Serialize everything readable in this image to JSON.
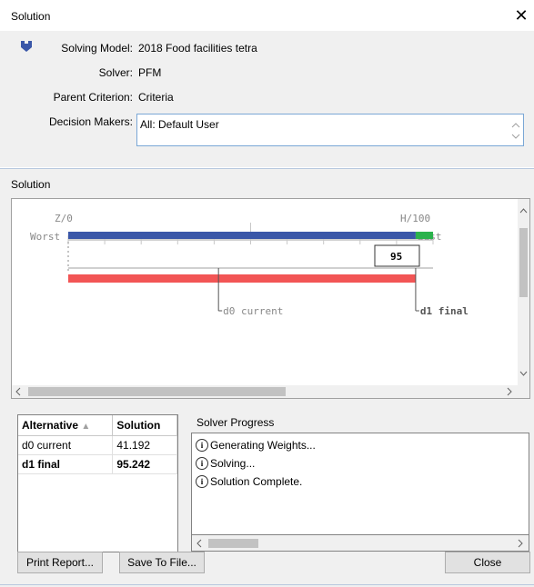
{
  "window": {
    "title": "Solution",
    "close_glyph": "✕"
  },
  "header": {
    "model_label": "Solving Model:",
    "model_value": "2018 Food facilities tetra",
    "solver_label": "Solver:",
    "solver_value": "PFM",
    "parent_label": "Parent Criterion:",
    "parent_value": "Criteria",
    "dm_label": "Decision Makers:",
    "dm_value": "All: Default User"
  },
  "section": {
    "solution_label": "Solution"
  },
  "chart_data": {
    "type": "bar",
    "left_top_label": "Z/0",
    "right_top_label": "H/100",
    "left_side_label": "Worst",
    "right_side_label": "Best",
    "score_box": "95",
    "scale": [
      0,
      100
    ],
    "colors": {
      "blue": "#3a57a8",
      "green": "#2bb24c",
      "red": "#f25555"
    },
    "markers": [
      {
        "name": "d0 current",
        "value": 41.192,
        "bold": false
      },
      {
        "name": "d1 final",
        "value": 95.242,
        "bold": true
      }
    ]
  },
  "alternatives": {
    "headers": [
      "Alternative",
      "Solution"
    ],
    "sort_indicator": "▲",
    "rows": [
      {
        "name": "d0 current",
        "value": "41.192",
        "bold": false
      },
      {
        "name": "d1 final",
        "value": "95.242",
        "bold": true
      }
    ]
  },
  "progress": {
    "label": "Solver Progress",
    "items": [
      "Generating Weights...",
      "Solving...",
      "Solution Complete."
    ]
  },
  "buttons": {
    "print": "Print Report...",
    "save": "Save To File...",
    "close": "Close"
  }
}
